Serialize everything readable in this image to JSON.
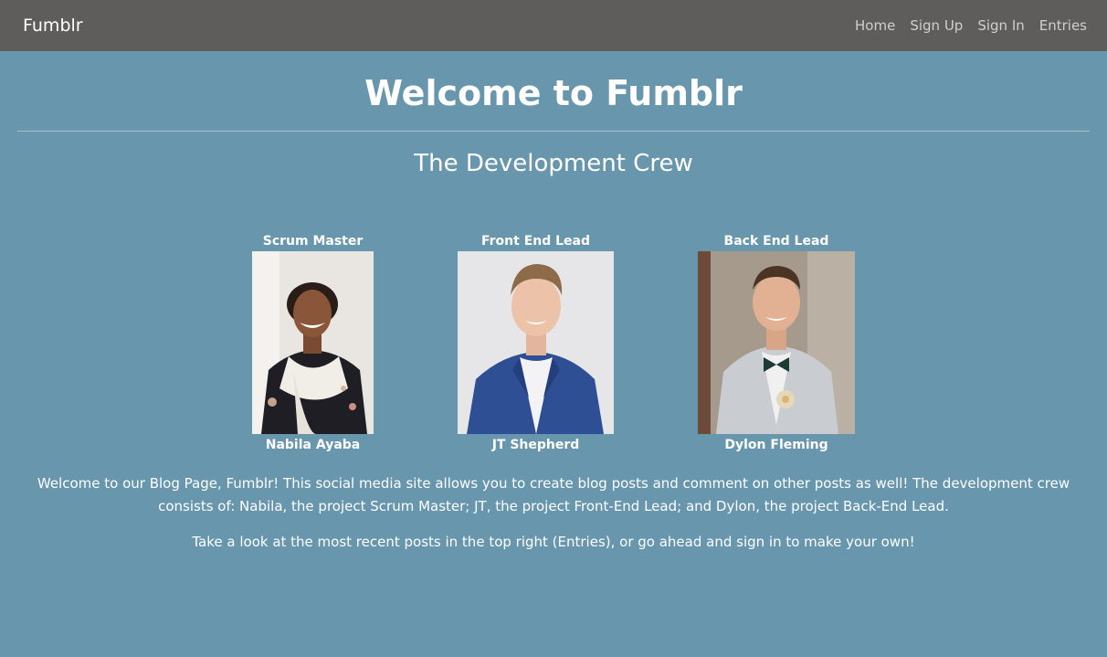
{
  "navbar": {
    "brand": "Fumblr",
    "links": [
      "Home",
      "Sign Up",
      "Sign In",
      "Entries"
    ]
  },
  "hero": {
    "title": "Welcome to Fumblr",
    "subtitle": "The Development Crew"
  },
  "crew": [
    {
      "role": "Scrum Master",
      "name": "Nabila Ayaba"
    },
    {
      "role": "Front End Lead",
      "name": "JT Shepherd"
    },
    {
      "role": "Back End Lead",
      "name": "Dylon Fleming"
    }
  ],
  "intro": {
    "paragraph1": "Welcome to our Blog Page, Fumblr! This social media site allows you to create blog posts and comment on other posts as well! The development crew consists of: Nabila, the project Scrum Master; JT, the project Front-End Lead; and Dylon, the project Back-End Lead.",
    "paragraph2": "Take a look at the most recent posts in the top right (Entries), or go ahead and sign in to make your own!"
  },
  "colors": {
    "background": "#6796ad",
    "navbar": "#5f5d5c",
    "nav_link": "#cfcfcf",
    "text": "#ffffff"
  }
}
